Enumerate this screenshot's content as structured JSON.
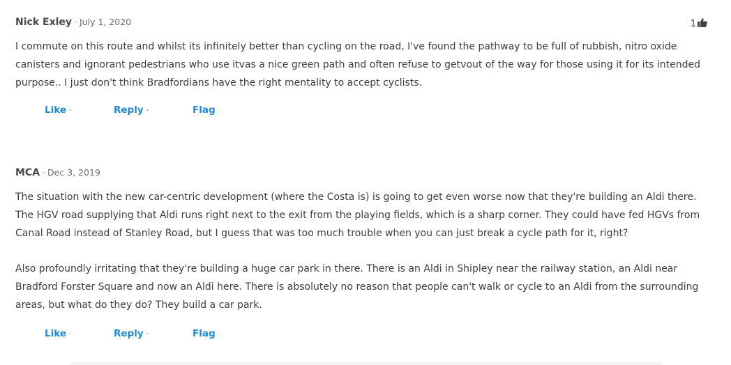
{
  "comments": [
    {
      "author": "Nick Exley",
      "separator": "·",
      "date": "July 1, 2020",
      "like_count": "1",
      "like_icon": "thumbs-up-icon",
      "paragraphs": [
        "I commute on this route and whilst its infinitely better than cycling on the road, I've found the pathway to be full of rubbish, nitro oxide canisters and ignorant pedestrians who use itvas a nice green path and often refuse to getvout of the way for those using it for its intended purpose.. I just don't think Bradfordians have the right mentality to accept cyclists."
      ],
      "actions": {
        "like": "Like",
        "reply": "Reply",
        "flag": "Flag",
        "dot": "·"
      }
    },
    {
      "author": "MCA",
      "separator": "·",
      "date": "Dec 3, 2019",
      "paragraphs": [
        "The situation with the new car-centric development (where the Costa is) is going to get even worse now that they're building an Aldi there. The HGV road supplying that Aldi runs right next to the exit from the playing fields, which is a sharp corner. They could have fed HGVs from Canal Road instead of Stanley Road, but I guess that was too much trouble when you can just break a cycle path for it, right?",
        "Also profoundly irritating that they're building a huge car park in there. There is an Aldi in Shipley near the railway station, an Aldi near Bradford Forster Square and now an Aldi here. There is absolutely no reason that people can't walk or cycle to an Aldi from the surrounding areas, but what do they do? They build a car park."
      ],
      "actions": {
        "like": "Like",
        "reply": "Reply",
        "flag": "Flag",
        "dot": "·"
      }
    }
  ],
  "colors": {
    "link": "#1e8bd6",
    "text": "#3d3d3d",
    "meta": "#6b6b6b"
  }
}
